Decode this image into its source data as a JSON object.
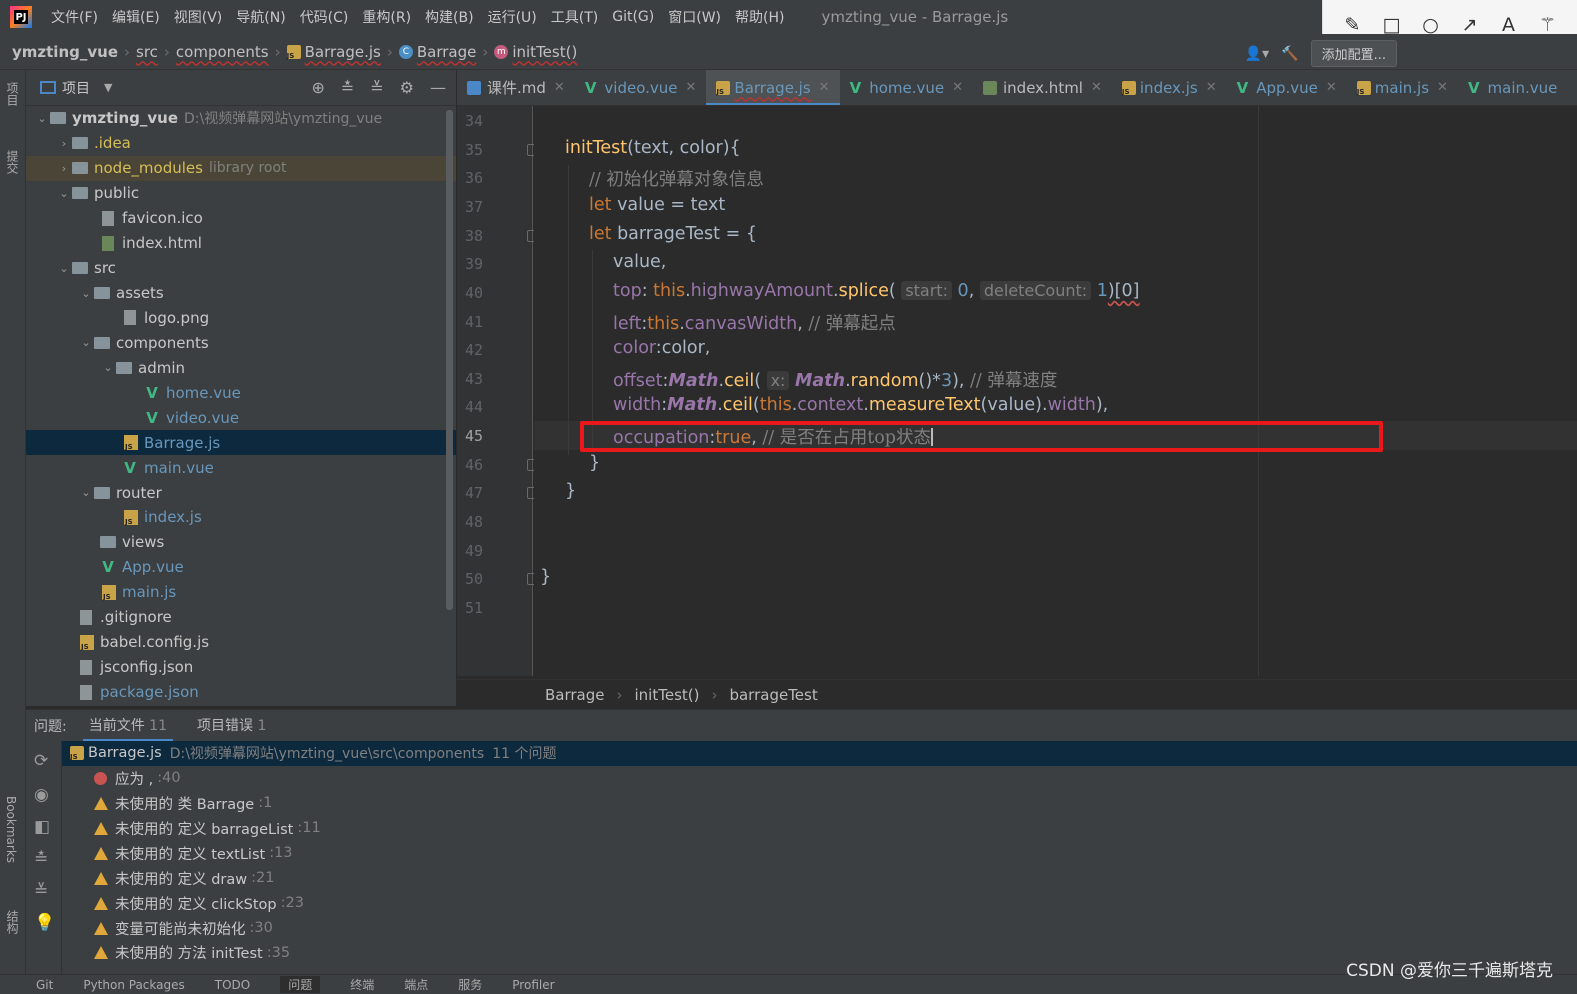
{
  "menu": {
    "items": [
      "文件(F)",
      "编辑(E)",
      "视图(V)",
      "导航(N)",
      "代码(C)",
      "重构(R)",
      "构建(B)",
      "运行(U)",
      "工具(T)",
      "Git(G)",
      "窗口(W)",
      "帮助(H)"
    ],
    "window_title": "ymzting_vue - Barrage.js"
  },
  "breadcrumb": {
    "project": "ymzting_vue",
    "src": "src",
    "components": "components",
    "file": "Barrage.js",
    "class": "Barrage",
    "method": "initTest()"
  },
  "toolbar": {
    "add_config": "添加配置..."
  },
  "left_strip": {
    "project": "项目",
    "commit": "提交",
    "bookmarks": "Bookmarks",
    "structure": "结构"
  },
  "project_panel": {
    "title": "项目"
  },
  "tree": [
    {
      "label": "ymzting_vue",
      "extra": "D:\\视频弹幕网站\\ymzting_vue"
    },
    {
      "label": ".idea"
    },
    {
      "label": "node_modules",
      "extra": "library root"
    },
    {
      "label": "public"
    },
    {
      "label": "favicon.ico"
    },
    {
      "label": "index.html"
    },
    {
      "label": "src"
    },
    {
      "label": "assets"
    },
    {
      "label": "logo.png"
    },
    {
      "label": "components"
    },
    {
      "label": "admin"
    },
    {
      "label": "home.vue"
    },
    {
      "label": "video.vue"
    },
    {
      "label": "Barrage.js"
    },
    {
      "label": "main.vue"
    },
    {
      "label": "router"
    },
    {
      "label": "index.js"
    },
    {
      "label": "views"
    },
    {
      "label": "App.vue"
    },
    {
      "label": "main.js"
    },
    {
      "label": ".gitignore"
    },
    {
      "label": "babel.config.js"
    },
    {
      "label": "jsconfig.json"
    },
    {
      "label": "package.json"
    }
  ],
  "tabs": [
    {
      "label": "课件.md"
    },
    {
      "label": "video.vue"
    },
    {
      "label": "Barrage.js"
    },
    {
      "label": "home.vue"
    },
    {
      "label": "index.html"
    },
    {
      "label": "index.js"
    },
    {
      "label": "App.vue"
    },
    {
      "label": "main.js"
    },
    {
      "label": "main.vue"
    }
  ],
  "line_numbers": [
    "34",
    "35",
    "36",
    "37",
    "38",
    "39",
    "40",
    "41",
    "42",
    "43",
    "44",
    "45",
    "46",
    "47",
    "48",
    "49",
    "50",
    "51"
  ],
  "code": {
    "l35": {
      "a": "initTest",
      "b": "(text, color){"
    },
    "l36": "// 初始化弹幕对象信息",
    "l37": {
      "kw": "let",
      "rest": " value = text"
    },
    "l38": {
      "kw": "let",
      "rest": " barrageTest = {"
    },
    "l39": "value,",
    "l40": {
      "prop": "top",
      "c": ": ",
      "this": "this",
      "dot": ".",
      "p2": "highwayAmount",
      "d2": ".",
      "fn": "splice",
      "o": "( ",
      "h1": "start:",
      "n1": "0",
      ",": ", ",
      "h2": "deleteCount:",
      "n2": "1",
      "end": ")[0]"
    },
    "l41": {
      "prop": "left",
      "c": ":",
      "this": "this",
      "dot": ".",
      "p2": "canvasWidth",
      "comma": ", ",
      "cm": "// 弹幕起点"
    },
    "l42": {
      "prop": "color",
      "rest": ":color,"
    },
    "l43": {
      "prop": "offset",
      "c": ":",
      "m": "Math",
      "dot": ".",
      "fn": "ceil",
      "o": "( ",
      "h": "x:",
      "m2": "Math",
      "d2": ".",
      "fn2": "random",
      "rest": "()*",
      "n": "3",
      "cl": "), ",
      "cm": "// 弹幕速度"
    },
    "l44": {
      "prop": "width",
      "c": ":",
      "m": "Math",
      "dot": ".",
      "fn": "ceil",
      "o": "(",
      "this": "this",
      "d2": ".",
      "p2": "context",
      "d3": ".",
      "fn2": "measureText",
      "rest": "(value).",
      "p3": "width",
      "cl": "),"
    },
    "l45": {
      "prop": "occupation",
      "c": ":",
      "kw": "true",
      "comma": ", ",
      "cm": "// 是否在占用top状态"
    },
    "l46": "}",
    "l47": "}",
    "l50": "}"
  },
  "editor_breadcrumb": [
    "Barrage",
    "initTest()",
    "barrageTest"
  ],
  "problems": {
    "label": "问题:",
    "tab_current": "当前文件",
    "tab_current_count": "11",
    "tab_project": "项目错误",
    "tab_project_count": "1",
    "file": "Barrage.js",
    "path": "D:\\视频弹幕网站\\ymzting_vue\\src\\components",
    "summary": "11 个问题",
    "items": [
      {
        "type": "error",
        "text": "应为 ,",
        "line": ":40"
      },
      {
        "type": "warning",
        "text": "未使用的 类 Barrage",
        "line": ":1"
      },
      {
        "type": "warning",
        "text": "未使用的 定义 barrageList",
        "line": ":11"
      },
      {
        "type": "warning",
        "text": "未使用的 定义 textList",
        "line": ":13"
      },
      {
        "type": "warning",
        "text": "未使用的 定义 draw",
        "line": ":21"
      },
      {
        "type": "warning",
        "text": "未使用的 定义 clickStop",
        "line": ":23"
      },
      {
        "type": "warning",
        "text": "变量可能尚未初始化",
        "line": ":30"
      },
      {
        "type": "warning",
        "text": "未使用的 方法 initTest",
        "line": ":35"
      }
    ]
  },
  "statusbar": [
    "Git",
    "Python Packages",
    "TODO",
    "问题",
    "终端",
    "端点",
    "服务",
    "Profiler"
  ],
  "watermark": "CSDN @爱你三千遍斯塔克",
  "colors": {
    "accent": "#4a88c7",
    "highlight_box": "#e8181b",
    "selection": "#0d293e"
  }
}
